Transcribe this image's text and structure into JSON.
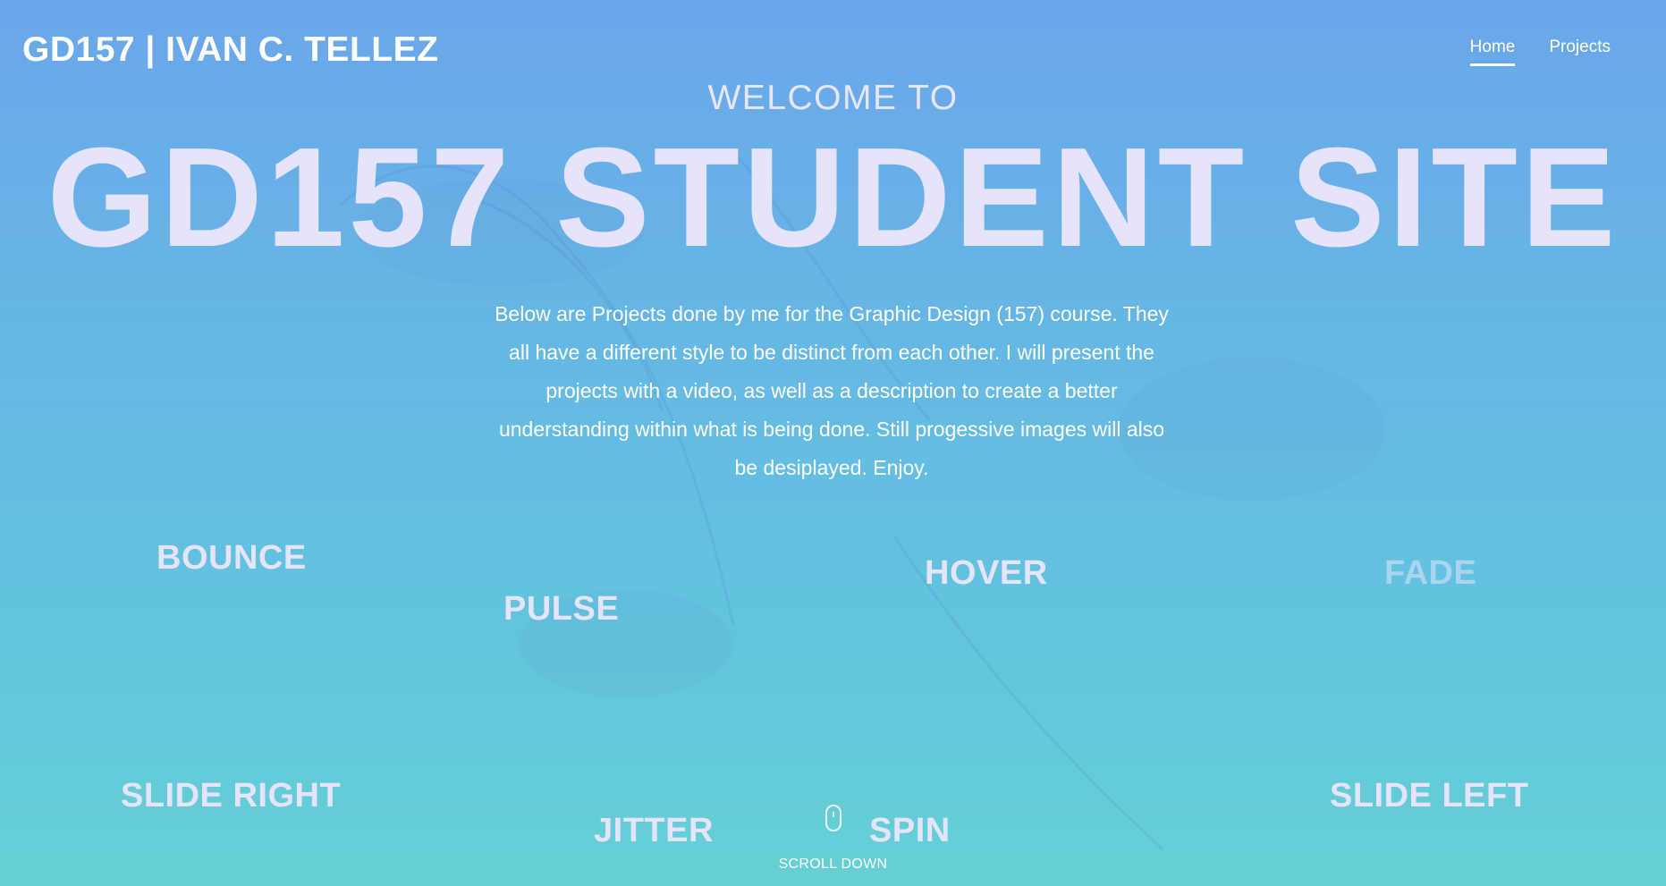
{
  "nav": {
    "brand": "GD157 | IVAN C. TELLEZ",
    "links": [
      {
        "label": "Home",
        "active": true
      },
      {
        "label": "Projects",
        "active": false
      }
    ]
  },
  "hero": {
    "welcome": "WELCOME TO",
    "title": "GD157 STUDENT SITE",
    "intro": "Below are Projects done by me for the Graphic Design (157) course. They all have a different style to be distinct from each other. I will present the projects with a video, as well as a description to create a better understanding within what is being done. Still progessive images will also be desiplayed. Enjoy."
  },
  "animations": {
    "bounce": "BOUNCE",
    "pulse": "PULSE",
    "hover": "HOVER",
    "fade": "FADE",
    "slide_right": "SLIDE RIGHT",
    "jitter": "JITTER",
    "spin": "SPIN",
    "slide_left": "SLIDE LEFT"
  },
  "scroll": {
    "icon": "mouse-icon",
    "label": "SCROLL DOWN"
  },
  "colors": {
    "accent_text": "#e6e4fb",
    "bg_top": "#6aa6ea",
    "bg_bottom": "#66d0d4"
  }
}
